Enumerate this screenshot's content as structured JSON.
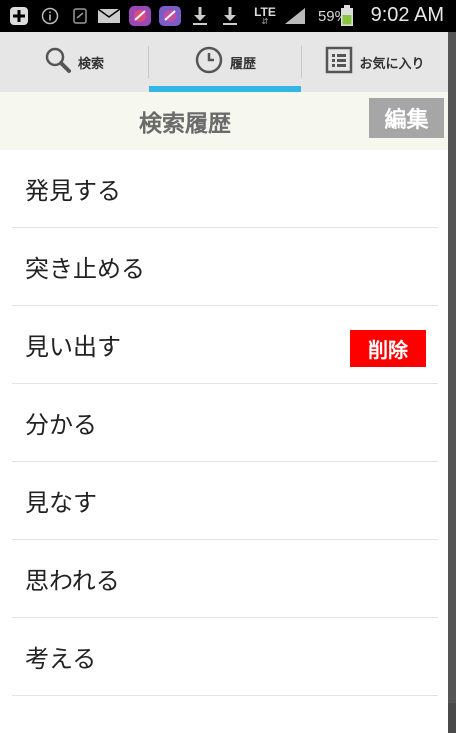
{
  "status_bar": {
    "battery_percent": "59%",
    "time": "9:02 AM",
    "network": "LTE",
    "icons": [
      "plus-icon",
      "info-icon",
      "sync-icon",
      "mail-icon",
      "app-icon",
      "app-icon",
      "download-icon",
      "download-icon",
      "lte-icon",
      "signal-icon",
      "battery-icon"
    ]
  },
  "tabs": [
    {
      "label": "検索",
      "icon": "search-icon"
    },
    {
      "label": "履歴",
      "icon": "clock-icon",
      "active": true
    },
    {
      "label": "お気に入り",
      "icon": "list-icon"
    }
  ],
  "header": {
    "title": "検索履歴",
    "edit_label": "編集"
  },
  "history": {
    "items": [
      {
        "label": "発見する"
      },
      {
        "label": "突き止める"
      },
      {
        "label": "見い出す",
        "delete_label": "削除"
      },
      {
        "label": "分かる"
      },
      {
        "label": "見なす"
      },
      {
        "label": "思われる"
      },
      {
        "label": "考える"
      }
    ]
  },
  "colors": {
    "accent": "#33b5e5",
    "delete": "#ff0000",
    "edit_button": "#a6a6a6",
    "header_bg": "#f6f7ef"
  }
}
